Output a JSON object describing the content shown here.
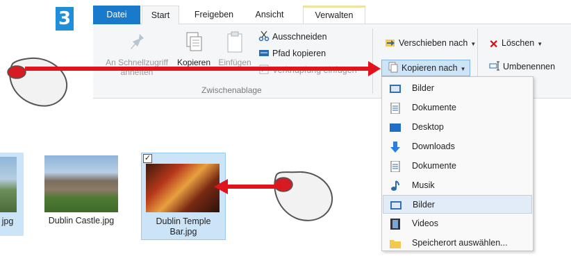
{
  "step_number": "3",
  "tabs": [
    {
      "label": "Datei"
    },
    {
      "label": "Start"
    },
    {
      "label": "Freigeben"
    },
    {
      "label": "Ansicht"
    },
    {
      "label": "Verwalten"
    }
  ],
  "clipboard": {
    "pin_label_1": "An Schnellzugriff",
    "pin_label_2": "anheften",
    "copy_label": "Kopieren",
    "paste_label": "Einfügen",
    "cut_label": "Ausschneiden",
    "copy_path_label": "Pfad kopieren",
    "paste_shortcut_label": "Verknüpfung einfügen",
    "group_label": "Zwischenablage"
  },
  "organize": {
    "move_to_label": "Verschieben nach",
    "copy_to_label": "Kopieren nach",
    "delete_label": "Löschen",
    "rename_label": "Umbenennen"
  },
  "copy_menu": [
    {
      "label": "Bilder",
      "icon": "pictures-icon"
    },
    {
      "label": "Dokumente",
      "icon": "document-icon"
    },
    {
      "label": "Desktop",
      "icon": "desktop-icon"
    },
    {
      "label": "Downloads",
      "icon": "download-icon"
    },
    {
      "label": "Dokumente",
      "icon": "document-icon"
    },
    {
      "label": "Musik",
      "icon": "music-icon"
    },
    {
      "label": "Bilder",
      "icon": "pictures-icon"
    },
    {
      "label": "Videos",
      "icon": "video-icon"
    },
    {
      "label": "Speicherort auswählen...",
      "icon": "folder-icon"
    }
  ],
  "files": [
    {
      "name": "jpg"
    },
    {
      "name": "Dublin Castle.jpg"
    },
    {
      "name_line1": "Dublin Temple",
      "name_line2": "Bar.jpg"
    }
  ],
  "colors": {
    "accent": "#1979ca",
    "arrow": "#e1141d",
    "selection": "#cce4f7"
  }
}
